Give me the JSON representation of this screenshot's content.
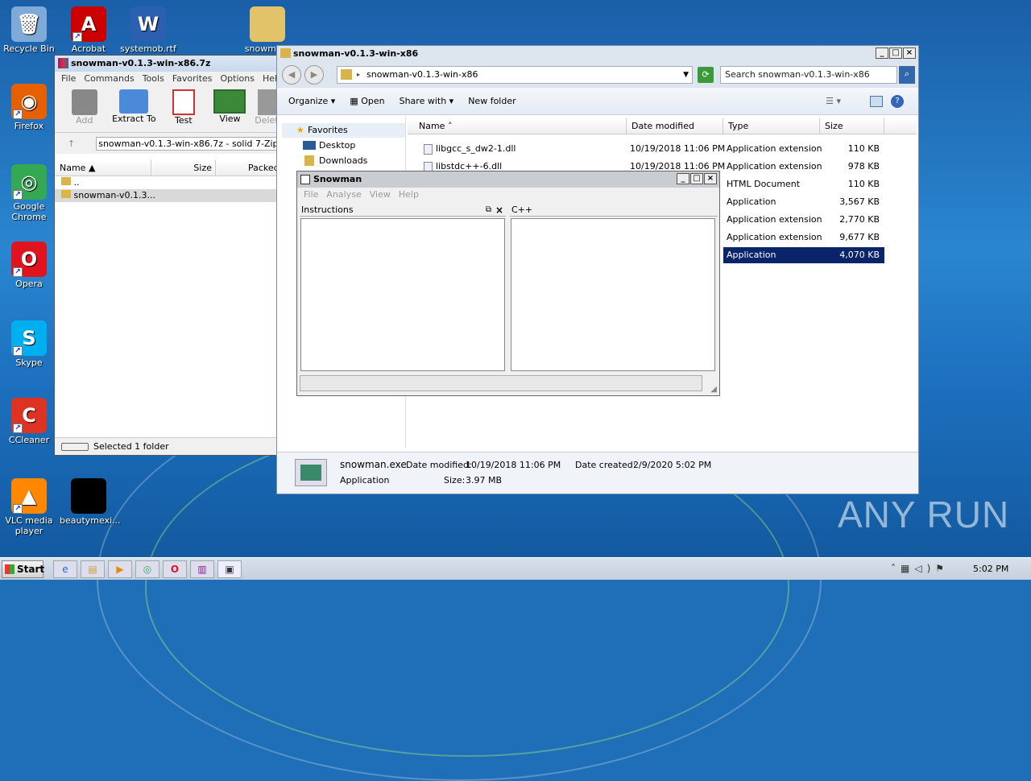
{
  "desktop": {
    "icons": [
      {
        "label": "Recycle Bin",
        "glyph": "🗑",
        "color": "#7fa9d6",
        "shortcut": false
      },
      {
        "label": "Acrobat",
        "glyph": "A",
        "color": "#c00",
        "shortcut": true
      },
      {
        "label": "systemob.rtf",
        "glyph": "W",
        "color": "#2b5fb0",
        "shortcut": false
      },
      {
        "label": "snowma...",
        "glyph": "",
        "color": "#e2c36a",
        "shortcut": false
      },
      {
        "label": "Firefox",
        "glyph": "◉",
        "color": "#e66000",
        "shortcut": true
      },
      {
        "label": "Google Chrome",
        "glyph": "◎",
        "color": "#34a853",
        "shortcut": true
      },
      {
        "label": "Opera",
        "glyph": "O",
        "color": "#e0141e",
        "shortcut": true
      },
      {
        "label": "Skype",
        "glyph": "S",
        "color": "#00aff0",
        "shortcut": true
      },
      {
        "label": "CCleaner",
        "glyph": "C",
        "color": "#d32",
        "shortcut": true
      },
      {
        "label": "VLC media player",
        "glyph": "▲",
        "color": "#f80",
        "shortcut": true
      },
      {
        "label": "beautymexi...",
        "glyph": "",
        "color": "#000",
        "shortcut": false
      }
    ]
  },
  "winrar": {
    "title": "snowman-v0.1.3-win-x86.7z",
    "menu": [
      "File",
      "Commands",
      "Tools",
      "Favorites",
      "Options",
      "Help"
    ],
    "toolbar": [
      "Add",
      "Extract To",
      "Test",
      "View",
      "Delet"
    ],
    "path": "snowman-v0.1.3-win-x86.7z - solid 7-Zip",
    "columns": [
      "Name",
      "Size",
      "Packed"
    ],
    "rows": [
      "..",
      "snowman-v0.1.3..."
    ],
    "status": "Selected 1 folder"
  },
  "explorer": {
    "title": "snowman-v0.1.3-win-x86",
    "address": "snowman-v0.1.3-win-x86",
    "search_placeholder": "Search snowman-v0.1.3-win-x86",
    "toolbar": {
      "organize": "Organize",
      "open": "Open",
      "share": "Share with",
      "new_folder": "New folder"
    },
    "nav": [
      "Favorites",
      "Desktop",
      "Downloads"
    ],
    "columns": [
      "Name",
      "Date modified",
      "Type",
      "Size"
    ],
    "files": [
      {
        "name": "libgcc_s_dw2-1.dll",
        "date": "10/19/2018 11:06 PM",
        "type": "Application extension",
        "size": "110 KB"
      },
      {
        "name": "libstdc++-6.dll",
        "date": "10/19/2018 11:06 PM",
        "type": "Application extension",
        "size": "978 KB"
      },
      {
        "name": "",
        "date": "",
        "type": "HTML Document",
        "size": "110 KB"
      },
      {
        "name": "",
        "date": "",
        "type": "Application",
        "size": "3,567 KB"
      },
      {
        "name": "",
        "date": "",
        "type": "Application extension",
        "size": "2,770 KB"
      },
      {
        "name": "",
        "date": "",
        "type": "Application extension",
        "size": "9,677 KB"
      },
      {
        "name": "",
        "date": "",
        "type": "Application",
        "size": "4,070 KB"
      }
    ],
    "details": {
      "name": "snowman.exe",
      "modified_label": "Date modified:",
      "modified": "10/19/2018 11:06 PM",
      "created_label": "Date created:",
      "created": "2/9/2020 5:02 PM",
      "type": "Application",
      "size_label": "Size:",
      "size": "3.97 MB"
    }
  },
  "snowman": {
    "title": "Snowman",
    "menu": [
      "File",
      "Analyse",
      "View",
      "Help"
    ],
    "left_panel": "Instructions",
    "right_panel": "C++"
  },
  "watermark": "ANY RUN",
  "taskbar": {
    "start": "Start",
    "clock": "5:02 PM"
  }
}
